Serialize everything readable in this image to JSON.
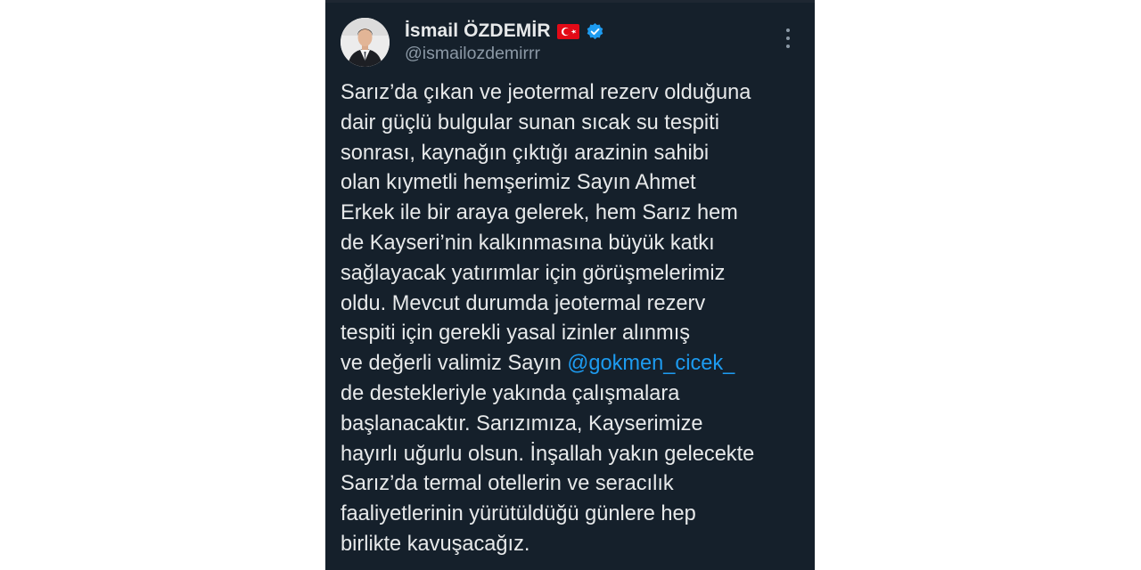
{
  "author": {
    "display_name": "İsmail ÖZDEMİR",
    "handle": "@ismailozdemirrr",
    "flag_icon": "turkish-flag-emoji",
    "verified_icon": "verified-badge-icon"
  },
  "menu": {
    "icon": "more-options-icon"
  },
  "tweet": {
    "text_part1": "Sarız’da çıkan ve jeotermal rezerv olduğuna\ndair güçlü bulgular sunan sıcak su tespiti\nsonrası, kaynağın çıktığı arazinin sahibi\nolan kıymetli hemşerimiz Sayın Ahmet\nErkek ile bir araya gelerek, hem Sarız hem\nde Kayseri’nin kalkınmasına büyük katkı\nsağlayacak yatırımlar için görüşmelerimiz\noldu. Mevcut durumda jeotermal rezerv\ntespiti için gerekli yasal izinler alınmış\nve değerli valimiz Sayın ",
    "mention": "@gokmen_cicek_",
    "text_part2": "\nde destekleriyle yakında çalışmalara\nbaşlanacaktır. Sarızımıza, Kayserimize\nhayırlı uğurlu olsun. İnşallah yakın gelecekte\nSarız’da termal otellerin ve seracılık\nfaaliyetlerinin yürütüldüğü günlere hep\nbirlikte kavuşacağız."
  },
  "colors": {
    "background": "#15202b",
    "text": "#e7e9ea",
    "secondary": "#8b98a5",
    "accent": "#1d9bf0"
  }
}
